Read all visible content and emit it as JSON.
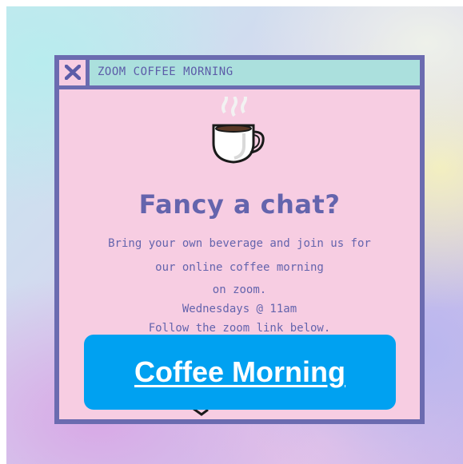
{
  "window": {
    "title": "ZOOM COFFEE MORNING",
    "close_icon": "close-icon"
  },
  "content": {
    "illustration": "coffee-cup-icon",
    "headline": "Fancy a chat?",
    "lines": [
      "Bring your own beverage and join us for",
      "our online coffee morning",
      "on zoom.",
      "Wednesdays @ 11am",
      "Follow the zoom link below."
    ]
  },
  "link_button": {
    "label": "Coffee Morning"
  },
  "colors": {
    "window_border": "#6b6bb0",
    "window_fill": "#f7cde2",
    "titlebar_fill": "#abe0dd",
    "text": "#6464ad",
    "button": "#00a1f1",
    "button_text": "#ffffff"
  }
}
